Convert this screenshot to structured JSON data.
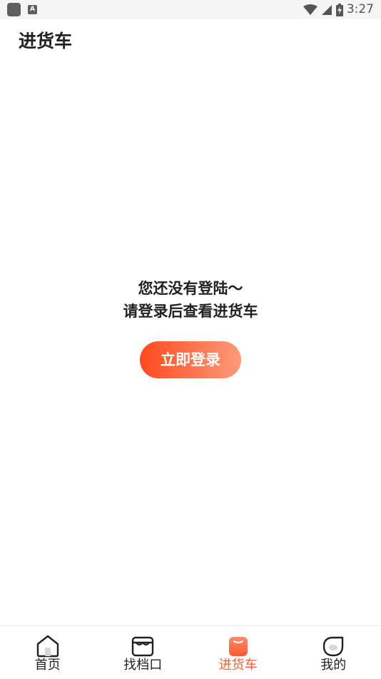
{
  "status_bar": {
    "time": "3:27",
    "badge_letter": "A"
  },
  "header": {
    "title": "进货车"
  },
  "empty_state": {
    "line1": "您还没有登陆～",
    "line2": "请登录后查看进货车",
    "login_button": "立即登录"
  },
  "tabs": [
    {
      "label": "首页",
      "icon": "home-icon",
      "active": false
    },
    {
      "label": "找档口",
      "icon": "store-icon",
      "active": false
    },
    {
      "label": "进货车",
      "icon": "cart-bag-icon",
      "active": true
    },
    {
      "label": "我的",
      "icon": "profile-icon",
      "active": false
    }
  ],
  "colors": {
    "accent": "#ff5a30",
    "button_gradient_start": "#ff4a1f",
    "button_gradient_end": "#ff9a7a"
  }
}
